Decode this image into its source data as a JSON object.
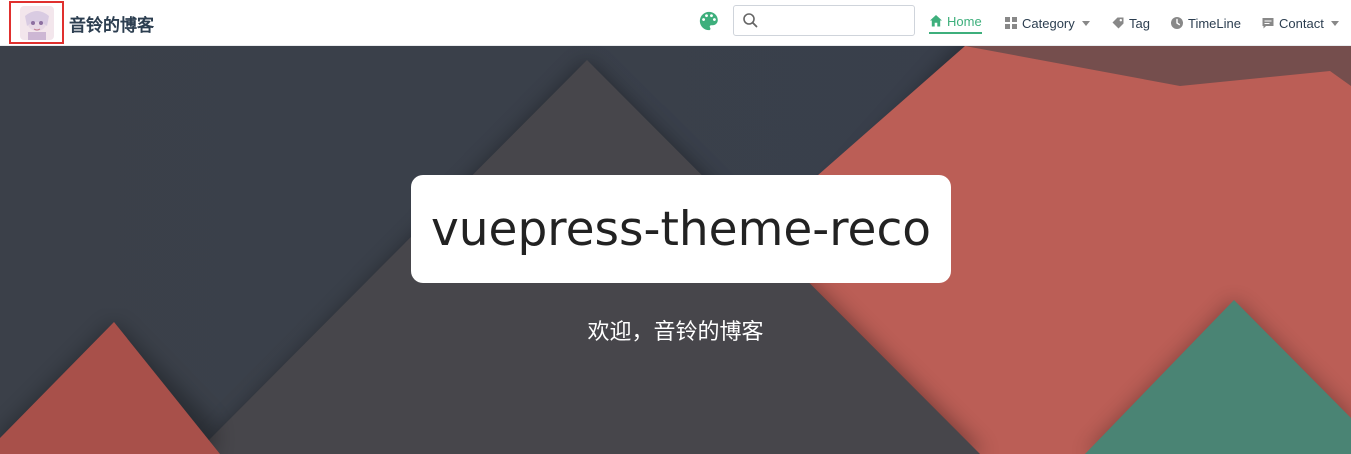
{
  "navbar": {
    "site_name": "音铃的博客",
    "search": {
      "value": "",
      "placeholder": ""
    },
    "items": [
      {
        "label": "Home",
        "icon": "home-icon",
        "active": true
      },
      {
        "label": "Category",
        "icon": "category-icon",
        "dropdown": true
      },
      {
        "label": "Tag",
        "icon": "tag-icon"
      },
      {
        "label": "TimeLine",
        "icon": "clock-icon"
      },
      {
        "label": "Contact",
        "icon": "message-icon",
        "dropdown": true
      }
    ]
  },
  "hero": {
    "title": "vuepress-theme-reco",
    "subtitle": "欢迎，音铃的博客"
  },
  "colors": {
    "accent": "#3eaf7c",
    "logo_highlight": "#e0302e",
    "hero_dark": "#3a404a",
    "hero_gray": "#47464b",
    "hero_red": "#bb5e56",
    "hero_teal": "#4a8474"
  }
}
